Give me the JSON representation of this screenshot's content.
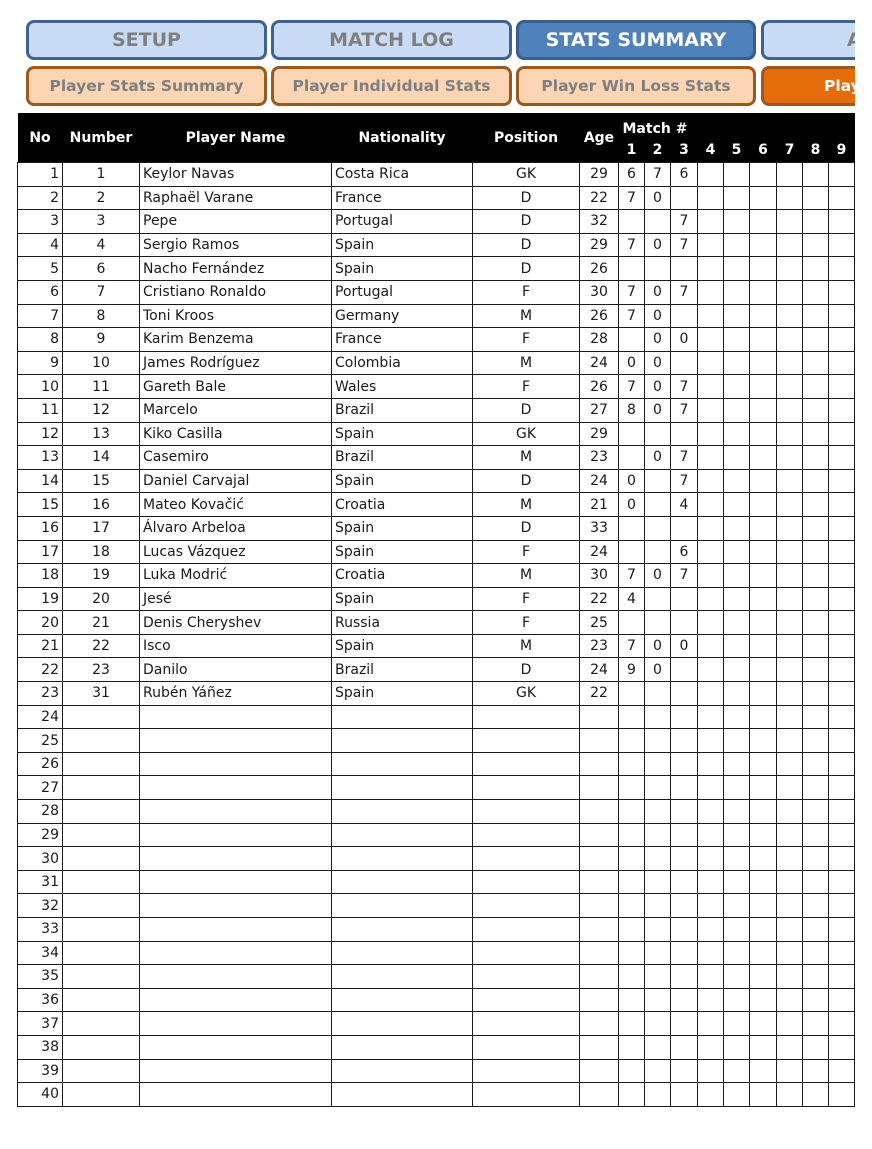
{
  "nav": {
    "top": [
      {
        "label": "SETUP",
        "active": false
      },
      {
        "label": "MATCH LOG",
        "active": false
      },
      {
        "label": "STATS SUMMARY",
        "active": true
      },
      {
        "label": "A",
        "active": false
      }
    ],
    "sub": [
      {
        "label": "Player Stats Summary",
        "active": false
      },
      {
        "label": "Player Individual Stats",
        "active": false
      },
      {
        "label": "Player Win Loss Stats",
        "active": false
      },
      {
        "label": "Play",
        "active": true
      }
    ]
  },
  "table": {
    "headers": {
      "no": "No",
      "number": "Number",
      "player_name": "Player Name",
      "nationality": "Nationality",
      "position": "Position",
      "age": "Age",
      "match_group": "Match #",
      "matches": [
        "1",
        "2",
        "3",
        "4",
        "5",
        "6",
        "7",
        "8",
        "9"
      ]
    },
    "rows": [
      {
        "no": "1",
        "number": "1",
        "name": "Keylor Navas",
        "nationality": "Costa Rica",
        "position": "GK",
        "age": "29",
        "m": [
          "6",
          "7",
          "6",
          "",
          "",
          "",
          "",
          "",
          ""
        ]
      },
      {
        "no": "2",
        "number": "2",
        "name": "Raphaël Varane",
        "nationality": "France",
        "position": "D",
        "age": "22",
        "m": [
          "7",
          "0",
          "",
          "",
          "",
          "",
          "",
          "",
          ""
        ]
      },
      {
        "no": "3",
        "number": "3",
        "name": "Pepe",
        "nationality": "Portugal",
        "position": "D",
        "age": "32",
        "m": [
          "",
          "",
          "7",
          "",
          "",
          "",
          "",
          "",
          ""
        ]
      },
      {
        "no": "4",
        "number": "4",
        "name": "Sergio Ramos",
        "nationality": "Spain",
        "position": "D",
        "age": "29",
        "m": [
          "7",
          "0",
          "7",
          "",
          "",
          "",
          "",
          "",
          ""
        ]
      },
      {
        "no": "5",
        "number": "6",
        "name": "Nacho Fernández",
        "nationality": "Spain",
        "position": "D",
        "age": "26",
        "m": [
          "",
          "",
          "",
          "",
          "",
          "",
          "",
          "",
          ""
        ]
      },
      {
        "no": "6",
        "number": "7",
        "name": "Cristiano Ronaldo",
        "nationality": "Portugal",
        "position": "F",
        "age": "30",
        "m": [
          "7",
          "0",
          "7",
          "",
          "",
          "",
          "",
          "",
          ""
        ]
      },
      {
        "no": "7",
        "number": "8",
        "name": "Toni Kroos",
        "nationality": "Germany",
        "position": "M",
        "age": "26",
        "m": [
          "7",
          "0",
          "",
          "",
          "",
          "",
          "",
          "",
          ""
        ]
      },
      {
        "no": "8",
        "number": "9",
        "name": "Karim Benzema",
        "nationality": "France",
        "position": "F",
        "age": "28",
        "m": [
          "",
          "0",
          "0",
          "",
          "",
          "",
          "",
          "",
          ""
        ]
      },
      {
        "no": "9",
        "number": "10",
        "name": "James Rodríguez",
        "nationality": "Colombia",
        "position": "M",
        "age": "24",
        "m": [
          "0",
          "0",
          "",
          "",
          "",
          "",
          "",
          "",
          ""
        ]
      },
      {
        "no": "10",
        "number": "11",
        "name": "Gareth Bale",
        "nationality": "Wales",
        "position": "F",
        "age": "26",
        "m": [
          "7",
          "0",
          "7",
          "",
          "",
          "",
          "",
          "",
          ""
        ]
      },
      {
        "no": "11",
        "number": "12",
        "name": "Marcelo",
        "nationality": "Brazil",
        "position": "D",
        "age": "27",
        "m": [
          "8",
          "0",
          "7",
          "",
          "",
          "",
          "",
          "",
          ""
        ]
      },
      {
        "no": "12",
        "number": "13",
        "name": "Kiko Casilla",
        "nationality": "Spain",
        "position": "GK",
        "age": "29",
        "m": [
          "",
          "",
          "",
          "",
          "",
          "",
          "",
          "",
          ""
        ]
      },
      {
        "no": "13",
        "number": "14",
        "name": "Casemiro",
        "nationality": "Brazil",
        "position": "M",
        "age": "23",
        "m": [
          "",
          "0",
          "7",
          "",
          "",
          "",
          "",
          "",
          ""
        ]
      },
      {
        "no": "14",
        "number": "15",
        "name": "Daniel Carvajal",
        "nationality": "Spain",
        "position": "D",
        "age": "24",
        "m": [
          "0",
          "",
          "7",
          "",
          "",
          "",
          "",
          "",
          ""
        ]
      },
      {
        "no": "15",
        "number": "16",
        "name": "Mateo Kovačić",
        "nationality": "Croatia",
        "position": "M",
        "age": "21",
        "m": [
          "0",
          "",
          "4",
          "",
          "",
          "",
          "",
          "",
          ""
        ]
      },
      {
        "no": "16",
        "number": "17",
        "name": "Álvaro Arbeloa",
        "nationality": "Spain",
        "position": "D",
        "age": "33",
        "m": [
          "",
          "",
          "",
          "",
          "",
          "",
          "",
          "",
          ""
        ]
      },
      {
        "no": "17",
        "number": "18",
        "name": "Lucas Vázquez",
        "nationality": "Spain",
        "position": "F",
        "age": "24",
        "m": [
          "",
          "",
          "6",
          "",
          "",
          "",
          "",
          "",
          ""
        ]
      },
      {
        "no": "18",
        "number": "19",
        "name": "Luka Modrić",
        "nationality": "Croatia",
        "position": "M",
        "age": "30",
        "m": [
          "7",
          "0",
          "7",
          "",
          "",
          "",
          "",
          "",
          ""
        ]
      },
      {
        "no": "19",
        "number": "20",
        "name": "Jesé",
        "nationality": "Spain",
        "position": "F",
        "age": "22",
        "m": [
          "4",
          "",
          "",
          "",
          "",
          "",
          "",
          "",
          ""
        ]
      },
      {
        "no": "20",
        "number": "21",
        "name": "Denis Cheryshev",
        "nationality": "Russia",
        "position": "F",
        "age": "25",
        "m": [
          "",
          "",
          "",
          "",
          "",
          "",
          "",
          "",
          ""
        ]
      },
      {
        "no": "21",
        "number": "22",
        "name": "Isco",
        "nationality": "Spain",
        "position": "M",
        "age": "23",
        "m": [
          "7",
          "0",
          "0",
          "",
          "",
          "",
          "",
          "",
          ""
        ]
      },
      {
        "no": "22",
        "number": "23",
        "name": "Danilo",
        "nationality": "Brazil",
        "position": "D",
        "age": "24",
        "m": [
          "9",
          "0",
          "",
          "",
          "",
          "",
          "",
          "",
          ""
        ]
      },
      {
        "no": "23",
        "number": "31",
        "name": "Rubén Yáñez",
        "nationality": "Spain",
        "position": "GK",
        "age": "22",
        "m": [
          "",
          "",
          "",
          "",
          "",
          "",
          "",
          "",
          ""
        ]
      },
      {
        "no": "24",
        "number": "",
        "name": "",
        "nationality": "",
        "position": "",
        "age": "",
        "m": [
          "",
          "",
          "",
          "",
          "",
          "",
          "",
          "",
          ""
        ]
      },
      {
        "no": "25",
        "number": "",
        "name": "",
        "nationality": "",
        "position": "",
        "age": "",
        "m": [
          "",
          "",
          "",
          "",
          "",
          "",
          "",
          "",
          ""
        ]
      },
      {
        "no": "26",
        "number": "",
        "name": "",
        "nationality": "",
        "position": "",
        "age": "",
        "m": [
          "",
          "",
          "",
          "",
          "",
          "",
          "",
          "",
          ""
        ]
      },
      {
        "no": "27",
        "number": "",
        "name": "",
        "nationality": "",
        "position": "",
        "age": "",
        "m": [
          "",
          "",
          "",
          "",
          "",
          "",
          "",
          "",
          ""
        ]
      },
      {
        "no": "28",
        "number": "",
        "name": "",
        "nationality": "",
        "position": "",
        "age": "",
        "m": [
          "",
          "",
          "",
          "",
          "",
          "",
          "",
          "",
          ""
        ]
      },
      {
        "no": "29",
        "number": "",
        "name": "",
        "nationality": "",
        "position": "",
        "age": "",
        "m": [
          "",
          "",
          "",
          "",
          "",
          "",
          "",
          "",
          ""
        ]
      },
      {
        "no": "30",
        "number": "",
        "name": "",
        "nationality": "",
        "position": "",
        "age": "",
        "m": [
          "",
          "",
          "",
          "",
          "",
          "",
          "",
          "",
          ""
        ]
      },
      {
        "no": "31",
        "number": "",
        "name": "",
        "nationality": "",
        "position": "",
        "age": "",
        "m": [
          "",
          "",
          "",
          "",
          "",
          "",
          "",
          "",
          ""
        ]
      },
      {
        "no": "32",
        "number": "",
        "name": "",
        "nationality": "",
        "position": "",
        "age": "",
        "m": [
          "",
          "",
          "",
          "",
          "",
          "",
          "",
          "",
          ""
        ]
      },
      {
        "no": "33",
        "number": "",
        "name": "",
        "nationality": "",
        "position": "",
        "age": "",
        "m": [
          "",
          "",
          "",
          "",
          "",
          "",
          "",
          "",
          ""
        ]
      },
      {
        "no": "34",
        "number": "",
        "name": "",
        "nationality": "",
        "position": "",
        "age": "",
        "m": [
          "",
          "",
          "",
          "",
          "",
          "",
          "",
          "",
          ""
        ]
      },
      {
        "no": "35",
        "number": "",
        "name": "",
        "nationality": "",
        "position": "",
        "age": "",
        "m": [
          "",
          "",
          "",
          "",
          "",
          "",
          "",
          "",
          ""
        ]
      },
      {
        "no": "36",
        "number": "",
        "name": "",
        "nationality": "",
        "position": "",
        "age": "",
        "m": [
          "",
          "",
          "",
          "",
          "",
          "",
          "",
          "",
          ""
        ]
      },
      {
        "no": "37",
        "number": "",
        "name": "",
        "nationality": "",
        "position": "",
        "age": "",
        "m": [
          "",
          "",
          "",
          "",
          "",
          "",
          "",
          "",
          ""
        ]
      },
      {
        "no": "38",
        "number": "",
        "name": "",
        "nationality": "",
        "position": "",
        "age": "",
        "m": [
          "",
          "",
          "",
          "",
          "",
          "",
          "",
          "",
          ""
        ]
      },
      {
        "no": "39",
        "number": "",
        "name": "",
        "nationality": "",
        "position": "",
        "age": "",
        "m": [
          "",
          "",
          "",
          "",
          "",
          "",
          "",
          "",
          ""
        ]
      },
      {
        "no": "40",
        "number": "",
        "name": "",
        "nationality": "",
        "position": "",
        "age": "",
        "m": [
          "",
          "",
          "",
          "",
          "",
          "",
          "",
          "",
          ""
        ]
      }
    ]
  }
}
